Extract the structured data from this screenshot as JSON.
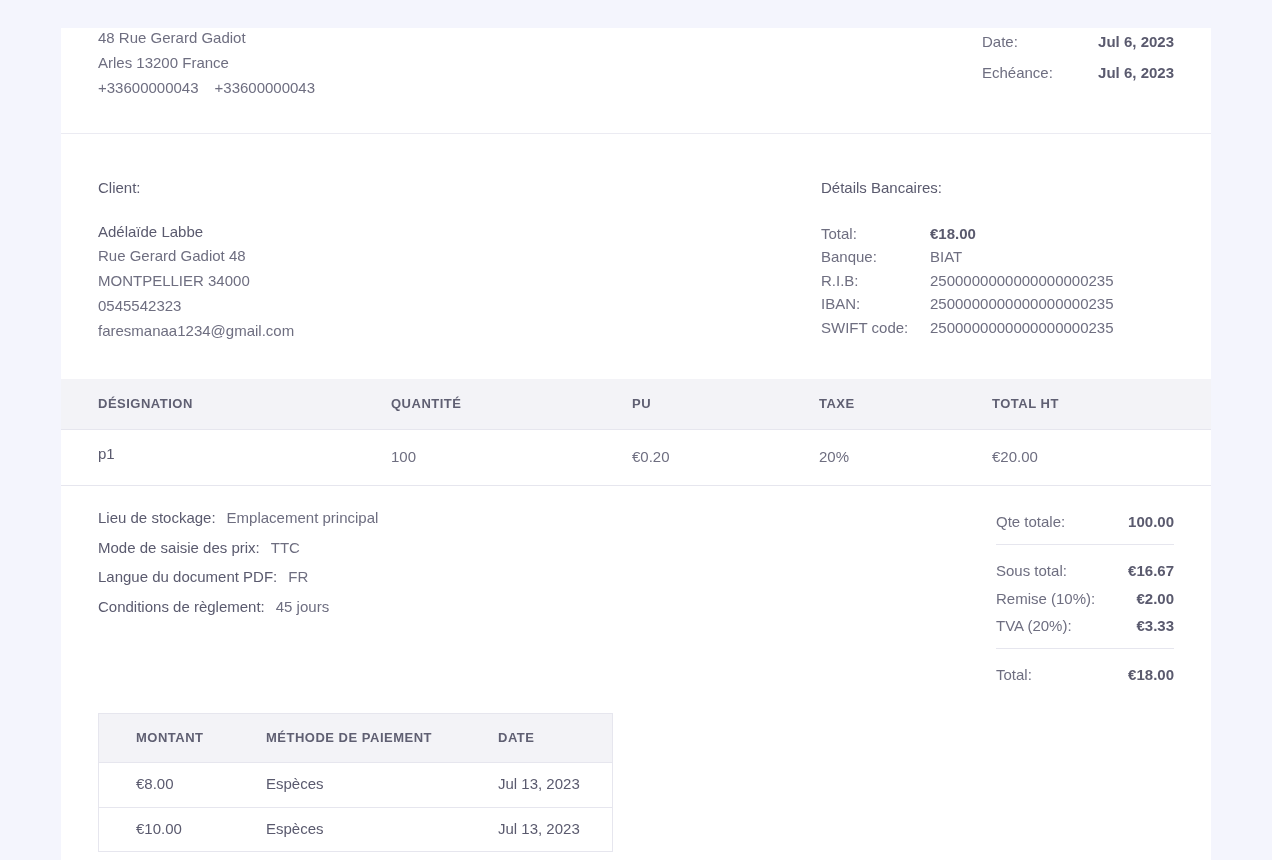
{
  "company": {
    "address_lines": [
      "48 Rue Gerard Gadiot",
      "Arles 13200 France"
    ],
    "phones": [
      "+33600000043",
      "+33600000043"
    ]
  },
  "dates": [
    {
      "label": "Date:",
      "value": "Jul 6, 2023"
    },
    {
      "label": "Echéance:",
      "value": "Jul 6, 2023"
    }
  ],
  "client": {
    "heading": "Client:",
    "name": "Adélaïde Labbe",
    "lines": [
      "Rue Gerard Gadiot 48",
      "MONTPELLIER 34000",
      "0545542323",
      "faresmanaa1234@gmail.com"
    ]
  },
  "bank": {
    "heading": "Détails Bancaires:",
    "rows": [
      {
        "label": "Total:",
        "value": "€18.00",
        "strong": true
      },
      {
        "label": "Banque:",
        "value": "BIAT",
        "strong": false
      },
      {
        "label": "R.I.B:",
        "value": "2500000000000000000235",
        "strong": false
      },
      {
        "label": "IBAN:",
        "value": "2500000000000000000235",
        "strong": false
      },
      {
        "label": "SWIFT code:",
        "value": "2500000000000000000235",
        "strong": false
      }
    ]
  },
  "items_table": {
    "columns": [
      "DÉSIGNATION",
      "QUANTITÉ",
      "PU",
      "TAXE",
      "TOTAL HT"
    ],
    "rows": [
      [
        "p1",
        "100",
        "€0.20",
        "20%",
        "€20.00"
      ]
    ]
  },
  "info": [
    {
      "label": "Lieu de stockage:",
      "value": "Emplacement principal"
    },
    {
      "label": "Mode de saisie des prix:",
      "value": "TTC"
    },
    {
      "label": "Langue du document PDF:",
      "value": "FR"
    },
    {
      "label": "Conditions de règlement:",
      "value": "45 jours"
    }
  ],
  "totals": [
    {
      "label": "Qte totale:",
      "value": "100.00",
      "divider_after": true
    },
    {
      "label": "Sous total:",
      "value": "€16.67",
      "divider_after": false
    },
    {
      "label": "Remise (10%):",
      "value": "€2.00",
      "divider_after": false
    },
    {
      "label": "TVA (20%):",
      "value": "€3.33",
      "divider_after": true
    },
    {
      "label": "Total:",
      "value": "€18.00",
      "divider_after": false
    }
  ],
  "payments_table": {
    "columns": [
      "MONTANT",
      "MÉTHODE DE PAIEMENT",
      "DATE"
    ],
    "rows": [
      [
        "€8.00",
        "Espèces",
        "Jul 13, 2023"
      ],
      [
        "€10.00",
        "Espèces",
        "Jul 13, 2023"
      ]
    ]
  }
}
